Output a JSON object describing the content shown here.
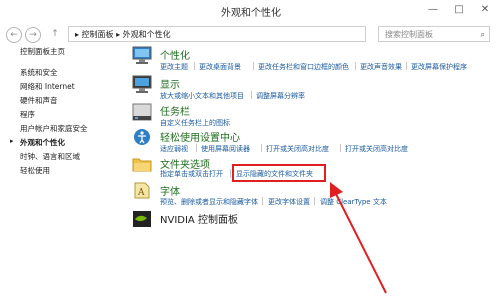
{
  "window": {
    "title": "外观和个性化",
    "min": "—",
    "max": "□",
    "close": "✕"
  },
  "address": {
    "back": "←",
    "forward": "→",
    "up": "↑",
    "path": "▸ 控制面板 ▸ 外观和个性化",
    "search_placeholder": "搜索控制面板"
  },
  "sidebar": {
    "items": [
      "控制面板主页",
      "系统和安全",
      "网络和 Internet",
      "硬件和声音",
      "程序",
      "用户帐户和家庭安全",
      "外观和个性化",
      "时钟、语言和区域",
      "轻松使用"
    ],
    "current_index": 6
  },
  "categories": [
    {
      "title": "个性化",
      "links": [
        "更改主题",
        "更改桌面背景",
        "更改任务栏和窗口边框的颜色",
        "更改声音效果",
        "更改屏幕保护程序"
      ]
    },
    {
      "title": "显示",
      "links": [
        "放大或缩小文本和其他项目",
        "调整屏幕分辨率"
      ]
    },
    {
      "title": "任务栏",
      "links": [
        "自定义任务栏上的图标"
      ]
    },
    {
      "title": "轻松使用设置中心",
      "links": [
        "适应弱视",
        "使用屏幕阅读器",
        "打开或关闭高对比度"
      ],
      "links2": [
        "打开或关闭高对比度"
      ]
    },
    {
      "title": "文件夹选项",
      "links": [
        "指定单击或双击打开",
        "显示隐藏的文件和文件夹"
      ]
    },
    {
      "title": "字体",
      "links": [
        "预览、删除或者显示和隐藏字体",
        "更改字体设置",
        "调整 ClearType 文本"
      ]
    },
    {
      "title": "NVIDIA 控制面板",
      "links": []
    }
  ],
  "colors": {
    "highlight": "#e02020",
    "link": "#1a5aa0",
    "title": "#1e6e1e"
  }
}
